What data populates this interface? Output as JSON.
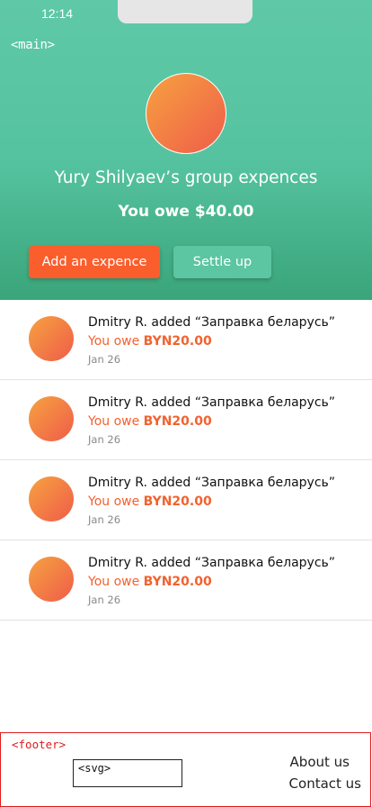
{
  "status_bar": {
    "time": "12:14"
  },
  "debug": {
    "main_tag": "<main>",
    "footer_tag": "<footer>",
    "svg_tag": "<svg>"
  },
  "group": {
    "title": "Yury Shilyaev’s group expences",
    "balance": "You owe $40.00",
    "add_button": "Add an expence",
    "settle_button": "Settle up"
  },
  "activity": [
    {
      "name": "Dmitry R.",
      "action": "added",
      "item": "“Заправка беларусь”",
      "owe_label": "You owe",
      "amount": "BYN20.00",
      "date": "Jan 26"
    },
    {
      "name": "Dmitry R.",
      "action": "added",
      "item": "“Заправка беларусь”",
      "owe_label": "You owe",
      "amount": "BYN20.00",
      "date": "Jan 26"
    },
    {
      "name": "Dmitry R.",
      "action": "added",
      "item": "“Заправка беларусь”",
      "owe_label": "You owe",
      "amount": "BYN20.00",
      "date": "Jan 26"
    },
    {
      "name": "Dmitry R.",
      "action": "added",
      "item": "“Заправка беларусь”",
      "owe_label": "You owe",
      "amount": "BYN20.00",
      "date": "Jan 26"
    }
  ],
  "footer": {
    "about": "About us",
    "contact": "Contact us"
  },
  "colors": {
    "header": "#55c29f",
    "accent": "#fa5e2c",
    "owe_text": "#f2622e",
    "settle": "#5cc5a1"
  }
}
